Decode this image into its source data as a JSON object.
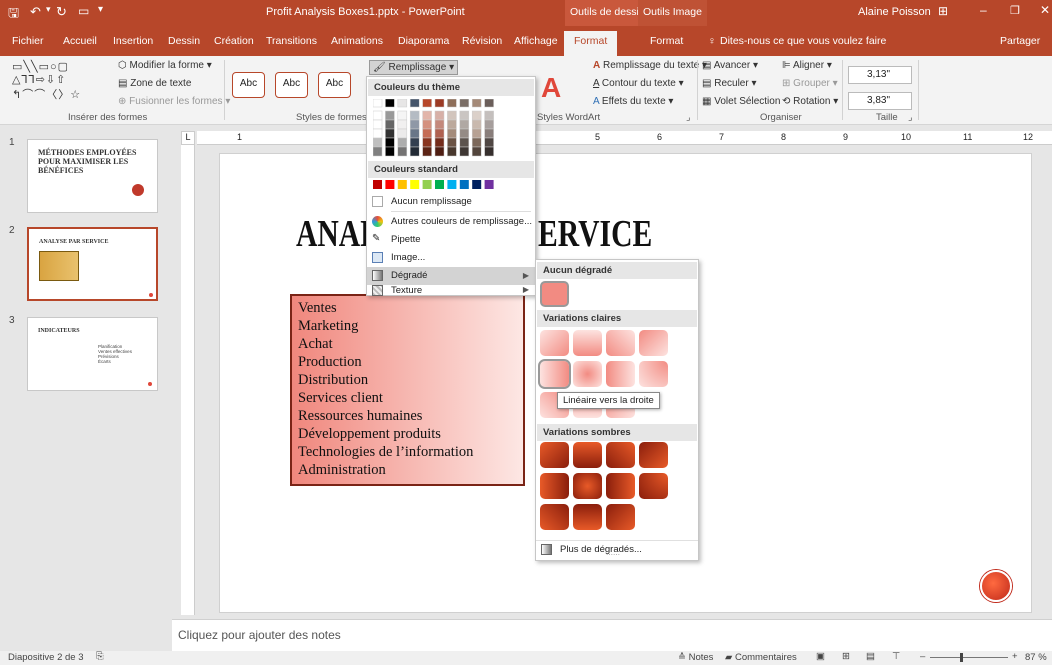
{
  "title": {
    "document": "Profit Analysis Boxes1.pptx - PowerPoint",
    "ctx_draw": "Outils de dessin",
    "ctx_image": "Outils Image",
    "user": "Alaine Poisson"
  },
  "tabs": [
    "Fichier",
    "Accueil",
    "Insertion",
    "Dessin",
    "Création",
    "Transitions",
    "Animations",
    "Diaporama",
    "Révision",
    "Affichage",
    "Format",
    "Format"
  ],
  "tell_me": "Dites-nous ce que vous voulez faire",
  "share": "Partager",
  "ribbon": {
    "modify_shape": "Modifier la forme",
    "text_box": "Zone de texte",
    "merge_shapes": "Fusionner les formes",
    "group_insert": "Insérer des formes",
    "abc": "Abc",
    "group_styles": "Styles de formes",
    "fill": "Remplissage",
    "text_fill": "Remplissage du texte",
    "text_outline": "Contour du texte",
    "text_effects": "Effets du texte",
    "group_wordart": "Styles WordArt",
    "bring_forward": "Avancer",
    "send_backward": "Reculer",
    "selection_pane": "Volet Sélection",
    "align": "Aligner",
    "group": "Grouper",
    "rotate": "Rotation",
    "group_arrange": "Organiser",
    "height": "3,13\"",
    "width": "3,83\"",
    "group_size": "Taille"
  },
  "ruler_numbers": [
    "1",
    "5",
    "6",
    "7",
    "8",
    "9",
    "10",
    "11",
    "12"
  ],
  "slides": [
    {
      "num": "1",
      "title": "MÉTHODES EMPLOYÉES POUR MAXIMISER LES BÉNÉFICES"
    },
    {
      "num": "2",
      "title": "ANALYSE PAR SERVICE"
    },
    {
      "num": "3",
      "title": "INDICATEURS",
      "bullets": [
        "Planification",
        "Ventes effectives",
        "Prévisions",
        "Écarts"
      ]
    }
  ],
  "slide": {
    "title_left": "ANAL",
    "title_right": "ERVICE",
    "items": [
      "Ventes",
      "Marketing",
      "Achat",
      "Production",
      "Distribution",
      "Services client",
      "Ressources humaines",
      "Développement produits",
      "Technologies de l’information",
      "Administration"
    ]
  },
  "fill_menu": {
    "theme_colors": "Couleurs du thème",
    "standard_colors": "Couleurs standard",
    "no_fill": "Aucun remplissage",
    "more_colors": "Autres couleurs de remplissage...",
    "eyedropper": "Pipette",
    "picture": "Image...",
    "gradient": "Dégradé",
    "texture": "Texture",
    "theme_top": [
      "#ffffff",
      "#000000",
      "#e7e6e6",
      "#44546a",
      "#b7472a",
      "#9c3a24",
      "#8f6f5a",
      "#7b6e66",
      "#a58a78",
      "#6b5e5a"
    ],
    "standard": [
      "#c00000",
      "#ff0000",
      "#ffc000",
      "#ffff00",
      "#92d050",
      "#00b050",
      "#00b0f0",
      "#0070c0",
      "#002060",
      "#7030a0"
    ]
  },
  "gradient_menu": {
    "none": "Aucun dégradé",
    "light": "Variations claires",
    "dark": "Variations sombres",
    "more": "Plus de dégradés...",
    "tooltip": "Linéaire vers la droite"
  },
  "notes_placeholder": "Cliquez pour ajouter des notes",
  "status": {
    "slide": "Diapositive 2 de 3",
    "notes": "Notes",
    "comments": "Commentaires",
    "zoom": "87 %"
  },
  "colors": {
    "accent": "#b7472a"
  }
}
